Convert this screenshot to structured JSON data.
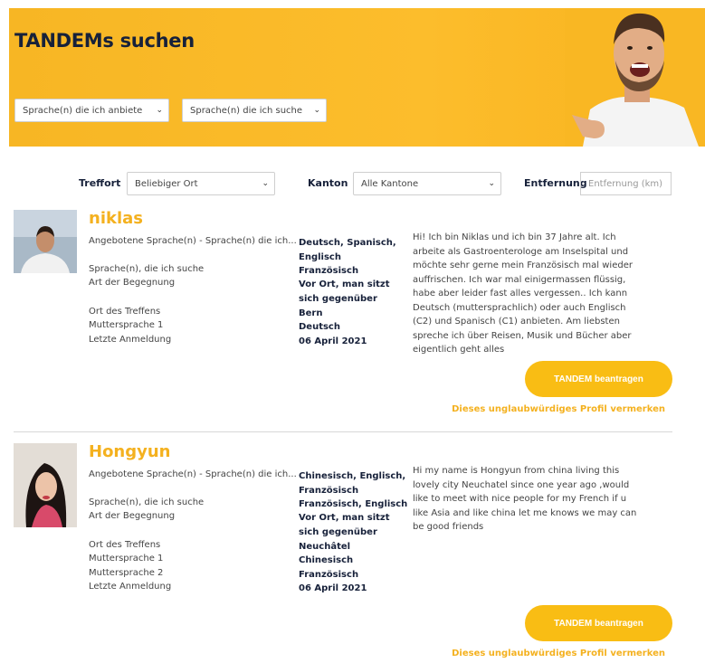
{
  "hero": {
    "title": "TANDEMs suchen",
    "offer_select": "Sprache(n) die ich anbiete",
    "seek_select": "Sprache(n) die ich suche"
  },
  "filters": {
    "meeting_place_label": "Treffort",
    "meeting_place_value": "Beliebiger Ort",
    "canton_label": "Kanton",
    "canton_value": "Alle Kantone",
    "distance_label": "Entfernung",
    "distance_placeholder": "Entfernung (km)"
  },
  "profiles": [
    {
      "name": "niklas",
      "labels": {
        "offered": "Angebotene Sprache(n) - Sprache(n) die ich...",
        "seeking": "Sprache(n), die ich suche",
        "meeting_type": "Art der Begegnung",
        "meeting_place": "Ort des Treffens",
        "mother1": "Muttersprache 1",
        "last_login": "Letzte Anmeldung"
      },
      "values": {
        "offered": "Deutsch, Spanisch, Englisch",
        "seeking": "Französisch",
        "meeting_type": "Vor Ort, man sitzt sich gegenüber",
        "meeting_place": "Bern",
        "mother1": "Deutsch",
        "last_login": "06 April 2021"
      },
      "description": "Hi! Ich bin Niklas und ich bin 37 Jahre alt. Ich arbeite als Gastroenterologe am Inselspital und möchte sehr gerne mein Französisch mal wieder auffrischen. Ich war mal einigermassen flüssig, habe aber leider fast alles vergessen.. Ich kann Deutsch (muttersprachlich) oder auch Englisch (C2) und Spanisch (C1) anbieten. Am liebsten spreche ich über Reisen, Musik und Bücher aber eigentlich geht alles",
      "request_button": "TANDEM beantragen",
      "report_link": "Dieses unglaubwürdiges Profil vermerken"
    },
    {
      "name": "Hongyun",
      "labels": {
        "offered": "Angebotene Sprache(n) - Sprache(n) die ich...",
        "seeking": "Sprache(n), die ich suche",
        "meeting_type": "Art der Begegnung",
        "meeting_place": "Ort des Treffens",
        "mother1": "Muttersprache 1",
        "mother2": "Muttersprache 2",
        "last_login": "Letzte Anmeldung"
      },
      "values": {
        "offered": "Chinesisch, Englisch, Französisch",
        "seeking": "Französisch, Englisch",
        "meeting_type": "Vor Ort, man sitzt sich gegenüber",
        "meeting_place": "Neuchâtel",
        "mother1": "Chinesisch",
        "mother2": "Französisch",
        "last_login": "06 April 2021"
      },
      "description": "Hi my name is Hongyun from china living this lovely city Neuchatel since one year ago ,would like to meet with nice people for my French if u like Asia and like china let me knows we may can be good friends",
      "request_button": "TANDEM beantragen",
      "report_link": "Dieses unglaubwürdiges Profil vermerken"
    }
  ],
  "colors": {
    "banner": "#fcbd2c",
    "accent": "#f4b11f",
    "button": "#f9bd14",
    "navy": "#17213a"
  }
}
